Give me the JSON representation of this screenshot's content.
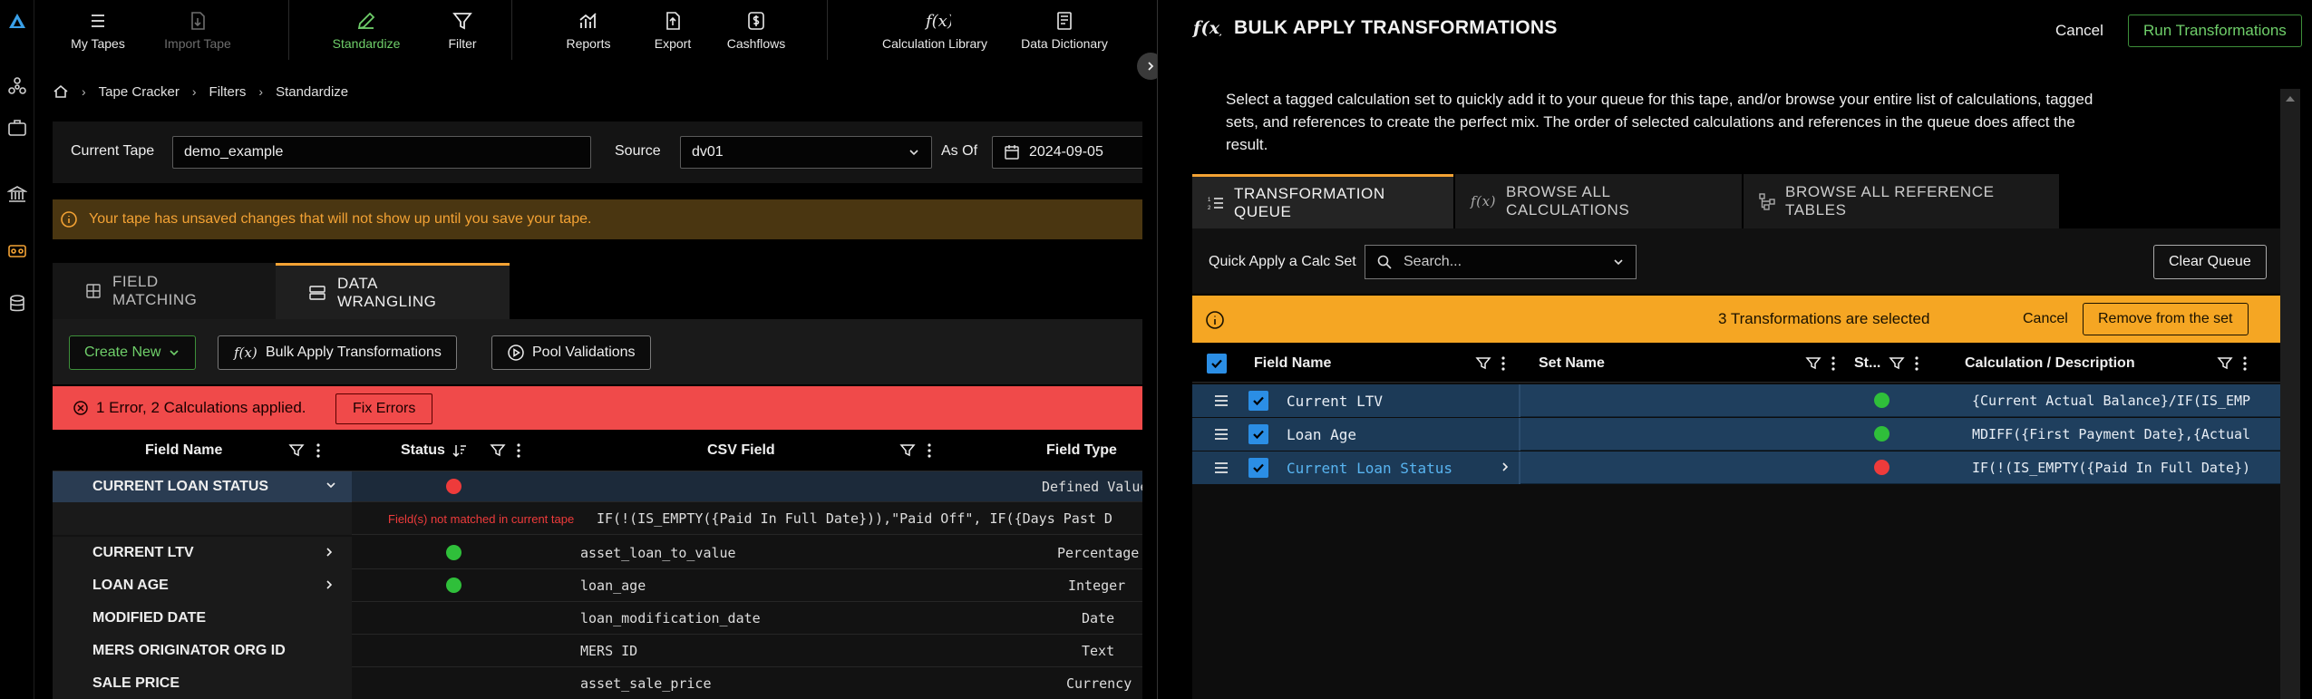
{
  "toolbar": {
    "items": [
      {
        "label": "My Tapes",
        "icon": "list-icon"
      },
      {
        "label": "Import Tape",
        "icon": "import-file-icon"
      },
      {
        "label": "Standardize",
        "icon": "pencil-icon"
      },
      {
        "label": "Filter",
        "icon": "filter-icon"
      },
      {
        "label": "Reports",
        "icon": "chart-icon"
      },
      {
        "label": "Export",
        "icon": "export-file-icon"
      },
      {
        "label": "Cashflows",
        "icon": "dollar-icon"
      },
      {
        "label": "Calculation Library",
        "icon": "function-icon"
      },
      {
        "label": "Data Dictionary",
        "icon": "book-icon"
      }
    ]
  },
  "breadcrumb": [
    "Tape Cracker",
    "Filters",
    "Standardize"
  ],
  "tape": {
    "current_label": "Current Tape",
    "current_value": "demo_example",
    "source_label": "Source",
    "source_value": "dv01",
    "asof_label": "As Of",
    "asof_value": "2024-09-05"
  },
  "warning": "Your tape has unsaved changes that will not show up until you save your tape.",
  "tabs": {
    "field_matching": "FIELD MATCHING",
    "data_wrangling": "DATA WRANGLING"
  },
  "actions": {
    "create_new": "Create New",
    "bulk_apply": "Bulk Apply Transformations",
    "pool_validations": "Pool Validations"
  },
  "error_bar": {
    "text": "1 Error, 2 Calculations applied.",
    "fix": "Fix Errors"
  },
  "left_table": {
    "headers": {
      "field_name": "Field Name",
      "status": "Status",
      "csv_field": "CSV Field",
      "field_type": "Field Type"
    },
    "error_note": "Field(s) not matched in current tape",
    "error_formula": "IF(!(IS_EMPTY({Paid In Full Date})),\"Paid Off\", IF({Days Past D",
    "rows": [
      {
        "name": "CURRENT LOAN STATUS",
        "status": "red",
        "csv": "",
        "type": "Defined Values"
      },
      {
        "name": "CURRENT LTV",
        "status": "green",
        "csv": "asset_loan_to_value",
        "type": "Percentage"
      },
      {
        "name": "LOAN AGE",
        "status": "green",
        "csv": "loan_age",
        "type": "Integer"
      },
      {
        "name": "MODIFIED DATE",
        "status": "",
        "csv": "loan_modification_date",
        "type": "Date"
      },
      {
        "name": "MERS ORIGINATOR ORG ID",
        "status": "",
        "csv": "MERS ID",
        "type": "Text"
      },
      {
        "name": "SALE PRICE",
        "status": "",
        "csv": "asset_sale_price",
        "type": "Currency"
      }
    ]
  },
  "panel": {
    "title": "BULK APPLY TRANSFORMATIONS",
    "cancel": "Cancel",
    "run": "Run Transformations",
    "description": "Select a tagged calculation set to quickly add it to your queue for this tape, and/or browse your entire list of calculations, tagged sets, and references to create the perfect mix. The order of selected calculations and references in the queue does affect the result.",
    "tabs": [
      "TRANSFORMATION QUEUE",
      "BROWSE ALL CALCULATIONS",
      "BROWSE ALL REFERENCE TABLES"
    ],
    "quick_apply_label": "Quick Apply a Calc Set",
    "search_placeholder": "Search...",
    "clear_queue": "Clear Queue",
    "selected_text": "3 Transformations are selected",
    "selected_cancel": "Cancel",
    "remove_from_set": "Remove from the set",
    "queue_headers": {
      "field_name": "Field Name",
      "set_name": "Set Name",
      "status": "St...",
      "calc": "Calculation / Description"
    },
    "queue_rows": [
      {
        "name": "Current LTV",
        "status": "green",
        "calc": "{Current Actual Balance}/IF(IS_EMP"
      },
      {
        "name": "Loan Age",
        "status": "green",
        "calc": "MDIFF({First Payment Date},{Actual"
      },
      {
        "name": "Current Loan Status",
        "status": "red",
        "calc": "IF(!(IS_EMPTY({Paid In Full Date})"
      }
    ]
  },
  "colors": {
    "accent": "#f3a234",
    "green": "#2fbf3a",
    "red": "#ee3b3b",
    "selected_row": "#1f3f5e"
  }
}
